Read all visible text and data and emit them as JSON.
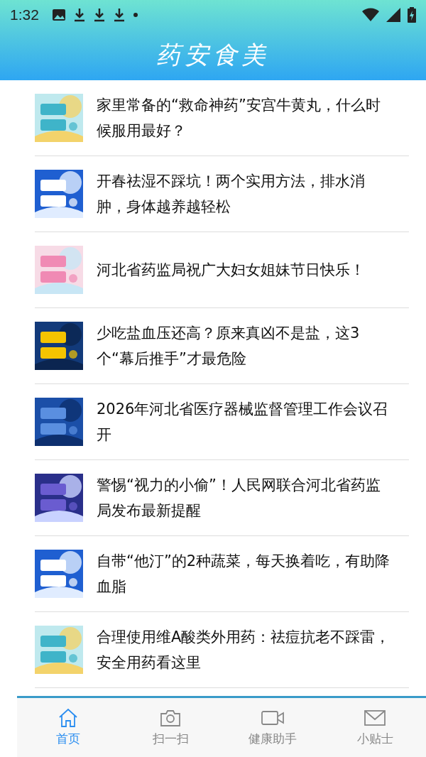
{
  "status_bar": {
    "time": "1:32"
  },
  "header": {
    "logo": "药安食美"
  },
  "articles": [
    {
      "title": "家里常备的“救命神药”安宫牛黄丸，什么时候服用最好？"
    },
    {
      "title": "开春祛湿不踩坑！两个实用方法，排水消肿，身体越养越轻松"
    },
    {
      "title": "河北省药监局祝广大妇女姐妹节日快乐！"
    },
    {
      "title": "少吃盐血压还高？原来真凶不是盐，这3个“幕后推手”才最危险"
    },
    {
      "title": "2026年河北省医疗器械监督管理工作会议召开"
    },
    {
      "title": "警惕“视力的小偷”！人民网联合河北省药监局发布最新提醒"
    },
    {
      "title": "自带“他汀”的2种蔬菜，每天换着吃，有助降血脂"
    },
    {
      "title": "合理使用维A酸类外用药：祛痘抗老不踩雷，安全用药看这里"
    }
  ],
  "tabs": [
    {
      "label": "首页",
      "selected": true
    },
    {
      "label": "扫一扫",
      "selected": false
    },
    {
      "label": "健康助手",
      "selected": false
    },
    {
      "label": "小贴士",
      "selected": false
    }
  ]
}
